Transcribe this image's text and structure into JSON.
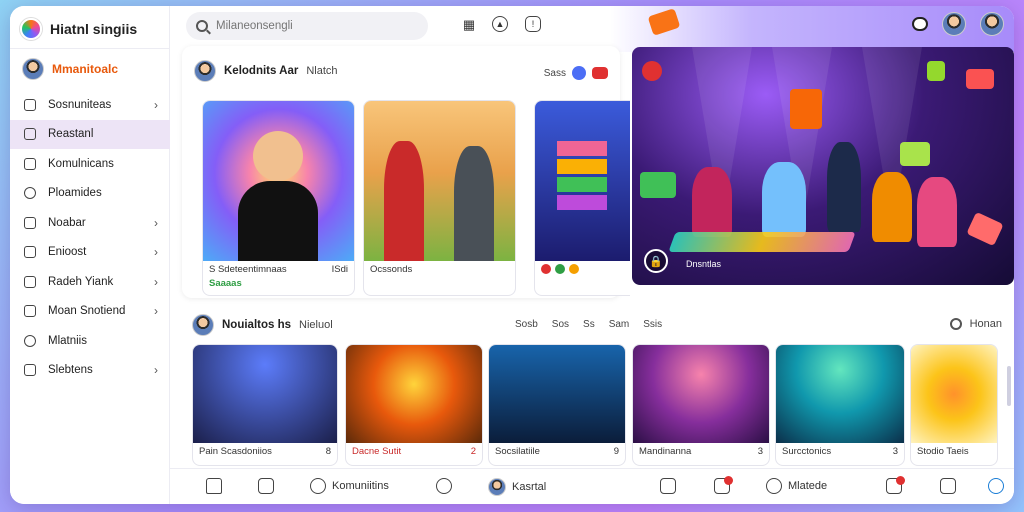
{
  "app": {
    "title": "Hiatnl singiis"
  },
  "search": {
    "placeholder": "Milaneonsengli"
  },
  "profile": {
    "name": "Mmanitoalc"
  },
  "sidebar": {
    "items": [
      {
        "label": "Sosnuniteas",
        "chevron": true,
        "active": false
      },
      {
        "label": "Reastanl",
        "chevron": false,
        "active": true
      },
      {
        "label": "Komulnicans",
        "chevron": false,
        "active": false
      },
      {
        "label": "Ploamides",
        "chevron": false,
        "active": false
      },
      {
        "label": "Noabar",
        "chevron": true,
        "active": false
      },
      {
        "label": "Enioost",
        "chevron": true,
        "active": false
      },
      {
        "label": "Radeh Yiank",
        "chevron": true,
        "active": false
      },
      {
        "label": "Moan Snotiend",
        "chevron": true,
        "active": false
      },
      {
        "label": "Mlatniis",
        "chevron": false,
        "active": false
      },
      {
        "label": "Slebtens",
        "chevron": true,
        "active": false
      }
    ]
  },
  "section1": {
    "title": "Kelodnits Aar",
    "subtitle": "Nlatch",
    "meta": "Sass",
    "cards": [
      {
        "caption": "S Sdeteentimnaas",
        "caption_right": "ISdi",
        "caption2": "Saaaas"
      },
      {
        "caption": "Ocssonds",
        "caption_right": "",
        "caption2": ""
      },
      {
        "caption": "",
        "caption_right": "",
        "caption2": ""
      }
    ]
  },
  "hero": {
    "label": "Dnsntlas"
  },
  "section2": {
    "title": "Nouialtos hs",
    "subtitle": "Nieluol",
    "meta_items": [
      "Sosb",
      "Sos",
      "Ss",
      "Sam",
      "Ssis"
    ],
    "search_label": "Honan",
    "cards": [
      {
        "caption": "Pain Scasdoniios",
        "count": "8"
      },
      {
        "caption": "Dacne Sutit",
        "count": "2"
      },
      {
        "caption": "Socsilatiile",
        "count": "9"
      },
      {
        "caption": "Mandinanna",
        "count": "3"
      },
      {
        "caption": "Surcctonics",
        "count": "3"
      },
      {
        "caption": "Stodio Taeis",
        "count": ""
      }
    ]
  },
  "bottom_bar": {
    "items": [
      {
        "label": ""
      },
      {
        "label": ""
      },
      {
        "label": "Komuniitins"
      },
      {
        "label": ""
      },
      {
        "label": "Kasrtal"
      },
      {
        "label": ""
      },
      {
        "label": ""
      },
      {
        "label": "Mlatede"
      },
      {
        "label": ""
      },
      {
        "label": ""
      }
    ]
  },
  "colors": {
    "accent": "#8b5cf6",
    "active_bg": "#ede4f6",
    "brand_text": "#e8590c"
  }
}
